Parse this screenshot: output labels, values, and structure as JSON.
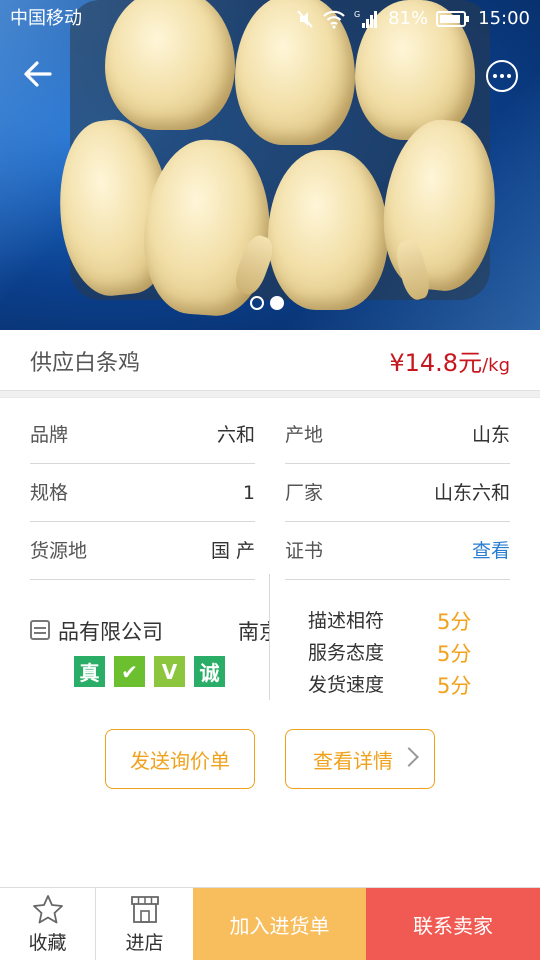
{
  "status_bar": {
    "carrier": "中国移动",
    "battery": "81%",
    "time": "15:00",
    "signal_label": "G"
  },
  "hero": {
    "image_count": 2,
    "active_index": 1
  },
  "product": {
    "name": "供应白条鸡",
    "price": "¥14.8元",
    "price_unit": "/kg",
    "price_color": "#c7161e"
  },
  "specs": [
    {
      "label": "品牌",
      "value": "六和",
      "label2": "产地",
      "value2": "山东"
    },
    {
      "label": "规格",
      "value": "1",
      "label2": "厂家",
      "value2": "山东六和"
    },
    {
      "label": "货源地",
      "value": "国 产",
      "label2": "证书",
      "value2": "查看"
    }
  ],
  "shop": {
    "name": "品有限公司",
    "city": "南京",
    "badges": [
      "真",
      "✔",
      "V",
      "诚"
    ]
  },
  "ratings": [
    {
      "label": "描述相符",
      "score": "5分"
    },
    {
      "label": "服务态度",
      "score": "5分"
    },
    {
      "label": "发货速度",
      "score": "5分"
    }
  ],
  "actions": {
    "inquiry": "发送询价单",
    "details": "查看详情"
  },
  "bottom_bar": {
    "favorite": "收藏",
    "shop": "进店",
    "add_to_cart": "加入进货单",
    "contact": "联系卖家",
    "cart_color": "#f8bd5c",
    "contact_color": "#f15a52"
  },
  "accent_color": "#f0a21c"
}
